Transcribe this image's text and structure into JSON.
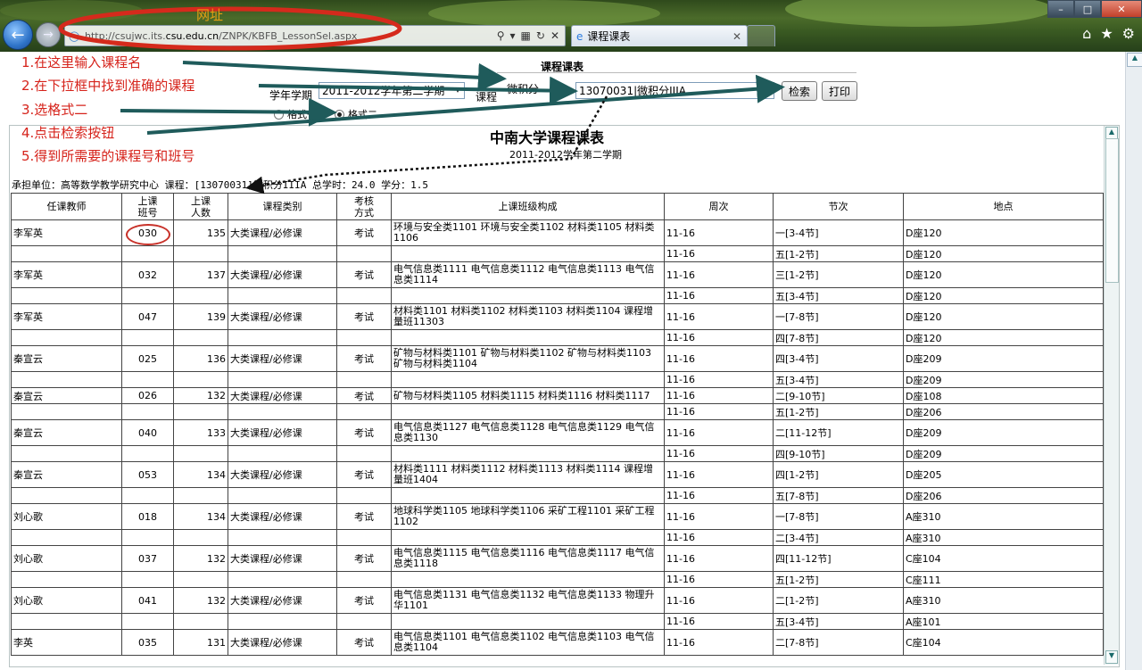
{
  "browser": {
    "url_prefix": "http://csujwc.its.",
    "url_domain": "csu.edu.cn",
    "url_path": "/ZNPK/KBFB_LessonSel.aspx",
    "tab_title": "课程课表",
    "url_note": "网址"
  },
  "form": {
    "title": "课程课表",
    "term_label": "学年学期",
    "term_value": "2011-2012学年第二学期",
    "course_label": "课程",
    "course_input": "微积分",
    "course_select": "13070031|微积分IIIA",
    "search_button": "检索",
    "print_button": "打印",
    "format_1": "格式一",
    "format_2": "格式二"
  },
  "annotations": [
    "1.在这里输入课程名",
    "2.在下拉框中找到准确的课程",
    "3.选格式二",
    "4.点击检索按钮",
    "5.得到所需要的课程号和班号"
  ],
  "report": {
    "title": "中南大学课程课表",
    "subtitle": "2011-2012学年第二学期",
    "info": "承担单位：高等数学教学研究中心   课程：[13070031]微积分IIIA   总学时：24.0   学分：1.5",
    "headers": [
      "任课教师",
      "上课\n班号",
      "上课\n人数",
      "课程类别",
      "考核\n方式",
      "上课班级构成",
      "周次",
      "节次",
      "地点"
    ],
    "rows": [
      {
        "teacher": "李军英",
        "class_no": "030",
        "count": "135",
        "category": "大类课程/必修课",
        "exam": "考试",
        "classes": "环境与安全类1101 环境与安全类1102 材料类1105 材料类1106",
        "weeks": "11-16",
        "period": "一[3-4节]",
        "place": "D座120",
        "weeks2": "11-16",
        "period2": "五[1-2节]",
        "place2": "D座120"
      },
      {
        "teacher": "李军英",
        "class_no": "032",
        "count": "137",
        "category": "大类课程/必修课",
        "exam": "考试",
        "classes": "电气信息类1111 电气信息类1112 电气信息类1113 电气信息类1114",
        "weeks": "11-16",
        "period": "三[1-2节]",
        "place": "D座120",
        "weeks2": "11-16",
        "period2": "五[3-4节]",
        "place2": "D座120"
      },
      {
        "teacher": "李军英",
        "class_no": "047",
        "count": "139",
        "category": "大类课程/必修课",
        "exam": "考试",
        "classes": "材料类1101 材料类1102 材料类1103 材料类1104 课程增量班11303",
        "weeks": "11-16",
        "period": "一[7-8节]",
        "place": "D座120",
        "weeks2": "11-16",
        "period2": "四[7-8节]",
        "place2": "D座120"
      },
      {
        "teacher": "秦宣云",
        "class_no": "025",
        "count": "136",
        "category": "大类课程/必修课",
        "exam": "考试",
        "classes": "矿物与材料类1101 矿物与材料类1102 矿物与材料类1103 矿物与材料类1104",
        "weeks": "11-16",
        "period": "四[3-4节]",
        "place": "D座209",
        "weeks2": "11-16",
        "period2": "五[3-4节]",
        "place2": "D座209"
      },
      {
        "teacher": "秦宣云",
        "class_no": "026",
        "count": "132",
        "category": "大类课程/必修课",
        "exam": "考试",
        "classes": "矿物与材料类1105 材料类1115 材料类1116 材料类1117",
        "weeks": "11-16",
        "period": "二[9-10节]",
        "place": "D座108",
        "weeks2": "11-16",
        "period2": "五[1-2节]",
        "place2": "D座206",
        "single": true
      },
      {
        "teacher": "秦宣云",
        "class_no": "040",
        "count": "133",
        "category": "大类课程/必修课",
        "exam": "考试",
        "classes": "电气信息类1127 电气信息类1128 电气信息类1129 电气信息类1130",
        "weeks": "11-16",
        "period": "二[11-12节]",
        "place": "D座209",
        "weeks2": "11-16",
        "period2": "四[9-10节]",
        "place2": "D座209"
      },
      {
        "teacher": "秦宣云",
        "class_no": "053",
        "count": "134",
        "category": "大类课程/必修课",
        "exam": "考试",
        "classes": "材料类1111 材料类1112 材料类1113 材料类1114 课程增量班1404",
        "weeks": "11-16",
        "period": "四[1-2节]",
        "place": "D座205",
        "weeks2": "11-16",
        "period2": "五[7-8节]",
        "place2": "D座206"
      },
      {
        "teacher": "刘心歌",
        "class_no": "018",
        "count": "134",
        "category": "大类课程/必修课",
        "exam": "考试",
        "classes": "地球科学类1105 地球科学类1106 采矿工程1101 采矿工程1102",
        "weeks": "11-16",
        "period": "一[7-8节]",
        "place": "A座310",
        "weeks2": "11-16",
        "period2": "二[3-4节]",
        "place2": "A座310"
      },
      {
        "teacher": "刘心歌",
        "class_no": "037",
        "count": "132",
        "category": "大类课程/必修课",
        "exam": "考试",
        "classes": "电气信息类1115 电气信息类1116 电气信息类1117 电气信息类1118",
        "weeks": "11-16",
        "period": "四[11-12节]",
        "place": "C座104",
        "weeks2": "11-16",
        "period2": "五[1-2节]",
        "place2": "C座111"
      },
      {
        "teacher": "刘心歌",
        "class_no": "041",
        "count": "132",
        "category": "大类课程/必修课",
        "exam": "考试",
        "classes": "电气信息类1131 电气信息类1132 电气信息类1133 物理升华1101",
        "weeks": "11-16",
        "period": "二[1-2节]",
        "place": "A座310",
        "weeks2": "11-16",
        "period2": "五[3-4节]",
        "place2": "A座101"
      },
      {
        "teacher": "李英",
        "class_no": "035",
        "count": "131",
        "category": "大类课程/必修课",
        "exam": "考试",
        "classes": "电气信息类1101 电气信息类1102 电气信息类1103 电气信息类1104",
        "weeks": "11-16",
        "period": "二[7-8节]",
        "place": "C座104",
        "weeks2": "",
        "period2": "",
        "place2": ""
      }
    ]
  }
}
